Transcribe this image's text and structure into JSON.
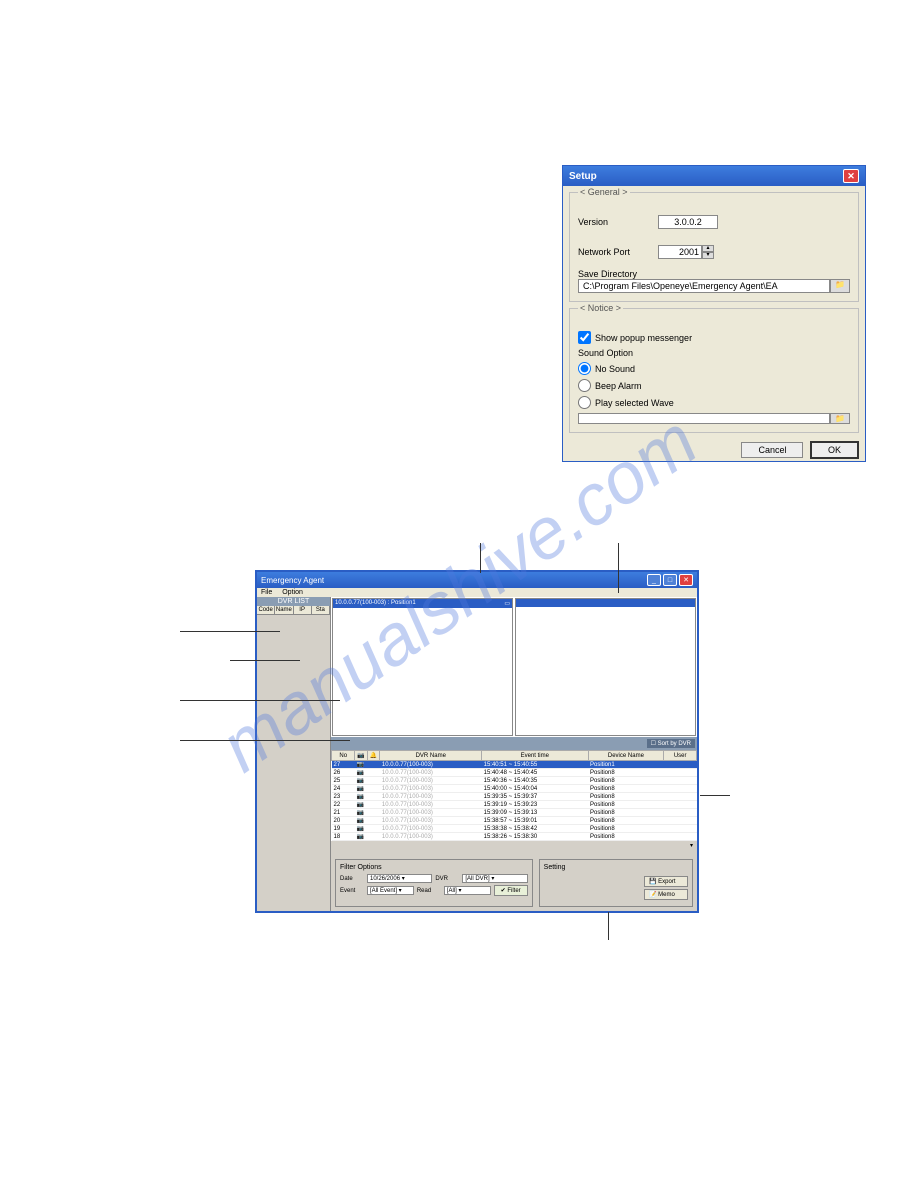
{
  "watermark": "manualshive.com",
  "setup": {
    "title": "Setup",
    "general_legend": "< General >",
    "version_label": "Version",
    "version_value": "3.0.0.2",
    "port_label": "Network Port",
    "port_value": "2001",
    "savedir_label": "Save Directory",
    "savedir_value": "C:\\Program Files\\Openeye\\Emergency Agent\\EA",
    "notice_legend": "< Notice >",
    "popup_label": "Show popup messenger",
    "sound_label": "Sound Option",
    "nosound_label": "No Sound",
    "beep_label": "Beep Alarm",
    "playwave_label": "Play selected Wave",
    "cancel": "Cancel",
    "ok": "OK"
  },
  "ea": {
    "title": "Emergency Agent",
    "menu_file": "File",
    "menu_option": "Option",
    "sidebar_title": "DVR LIST",
    "cols": [
      "Code",
      "Name",
      "IP",
      "Sta"
    ],
    "video1_title": "10.0.0.77(100-003) : Position1",
    "sort_label": "Sort by DVR",
    "thead": [
      "No",
      "",
      "",
      "DVR Name",
      "Event time",
      "Device Name",
      "User"
    ],
    "rows": [
      {
        "no": "27",
        "dvr": "10.0.0.77(100-003)",
        "time": "15:40:51 ~ 15:40:55",
        "dev": "Position1",
        "sel": true
      },
      {
        "no": "26",
        "dvr": "10.0.0.77(100-003)",
        "time": "15:40:48 ~ 15:40:45",
        "dev": "Position8"
      },
      {
        "no": "25",
        "dvr": "10.0.0.77(100-003)",
        "time": "15:40:36 ~ 15:40:35",
        "dev": "Position8"
      },
      {
        "no": "24",
        "dvr": "10.0.0.77(100-003)",
        "time": "15:40:00 ~ 15:40:04",
        "dev": "Position8"
      },
      {
        "no": "23",
        "dvr": "10.0.0.77(100-003)",
        "time": "15:39:35 ~ 15:39:37",
        "dev": "Position8"
      },
      {
        "no": "22",
        "dvr": "10.0.0.77(100-003)",
        "time": "15:39:19 ~ 15:39:23",
        "dev": "Position8"
      },
      {
        "no": "21",
        "dvr": "10.0.0.77(100-003)",
        "time": "15:39:09 ~ 15:39:13",
        "dev": "Position8"
      },
      {
        "no": "20",
        "dvr": "10.0.0.77(100-003)",
        "time": "15:38:57 ~ 15:39:01",
        "dev": "Position8"
      },
      {
        "no": "19",
        "dvr": "10.0.0.77(100-003)",
        "time": "15:38:38 ~ 15:38:42",
        "dev": "Position8"
      },
      {
        "no": "18",
        "dvr": "10.0.0.77(100-003)",
        "time": "15:38:26 ~ 15:38:30",
        "dev": "Position8"
      }
    ],
    "filter_title": "Filter Options",
    "date_label": "Date",
    "date_value": "10/26/2006",
    "dvr_label": "DVR",
    "dvr_value": "[All DVR]",
    "event_label": "Event",
    "event_value": "[All Event]",
    "read_label": "Read",
    "read_value": "[All]",
    "filter_btn": "Filter",
    "setting_title": "Setting",
    "export_btn": "Export",
    "memo_btn": "Memo"
  }
}
